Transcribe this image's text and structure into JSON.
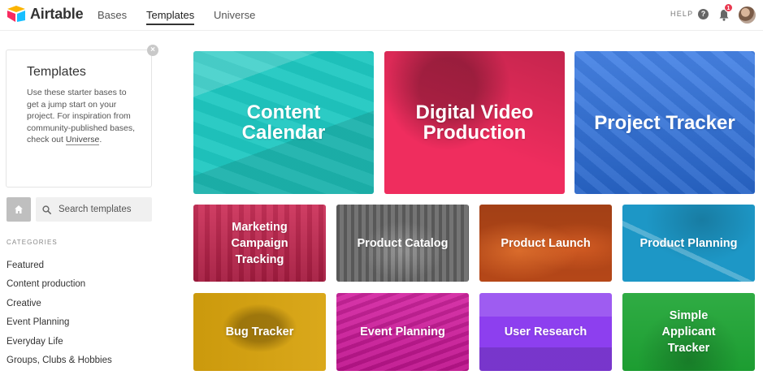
{
  "app": {
    "name": "Airtable"
  },
  "nav": {
    "items": [
      {
        "label": "Bases",
        "active": false
      },
      {
        "label": "Templates",
        "active": true
      },
      {
        "label": "Universe",
        "active": false
      }
    ],
    "help_label": "HELP",
    "help_icon": "?",
    "notification_count": "1"
  },
  "sidebar": {
    "info_card": {
      "title": "Templates",
      "text": "Use these starter bases to get a jump start on your project. For inspiration from community-published bases, check out ",
      "link": "Universe",
      "text_end": "."
    },
    "close_icon": "×",
    "search": {
      "placeholder": "Search templates"
    },
    "categories_heading": "CATEGORIES",
    "categories": [
      "Featured",
      "Content production",
      "Creative",
      "Event Planning",
      "Everyday Life",
      "Groups, Clubs & Hobbies"
    ]
  },
  "featured_templates": [
    {
      "title": "Content Calendar",
      "color": "#1fc8c1"
    },
    {
      "title": "Digital Video Production",
      "color": "#ef2d5e"
    },
    {
      "title": "Project Tracker",
      "color": "#2d72e2"
    }
  ],
  "templates": [
    {
      "title": "Marketing Campaign Tracking",
      "color": "#c9224e"
    },
    {
      "title": "Product Catalog",
      "color": "#6b6b6b"
    },
    {
      "title": "Product Launch",
      "color": "#b54718"
    },
    {
      "title": "Product Planning",
      "color": "#1d97c6"
    },
    {
      "title": "Bug Tracker",
      "color": "#d8a30d"
    },
    {
      "title": "Event Planning",
      "color": "#d0169b"
    },
    {
      "title": "User Research",
      "color": "#8d3fef"
    },
    {
      "title": "Simple Applicant Tracker",
      "color": "#1ea534"
    }
  ]
}
